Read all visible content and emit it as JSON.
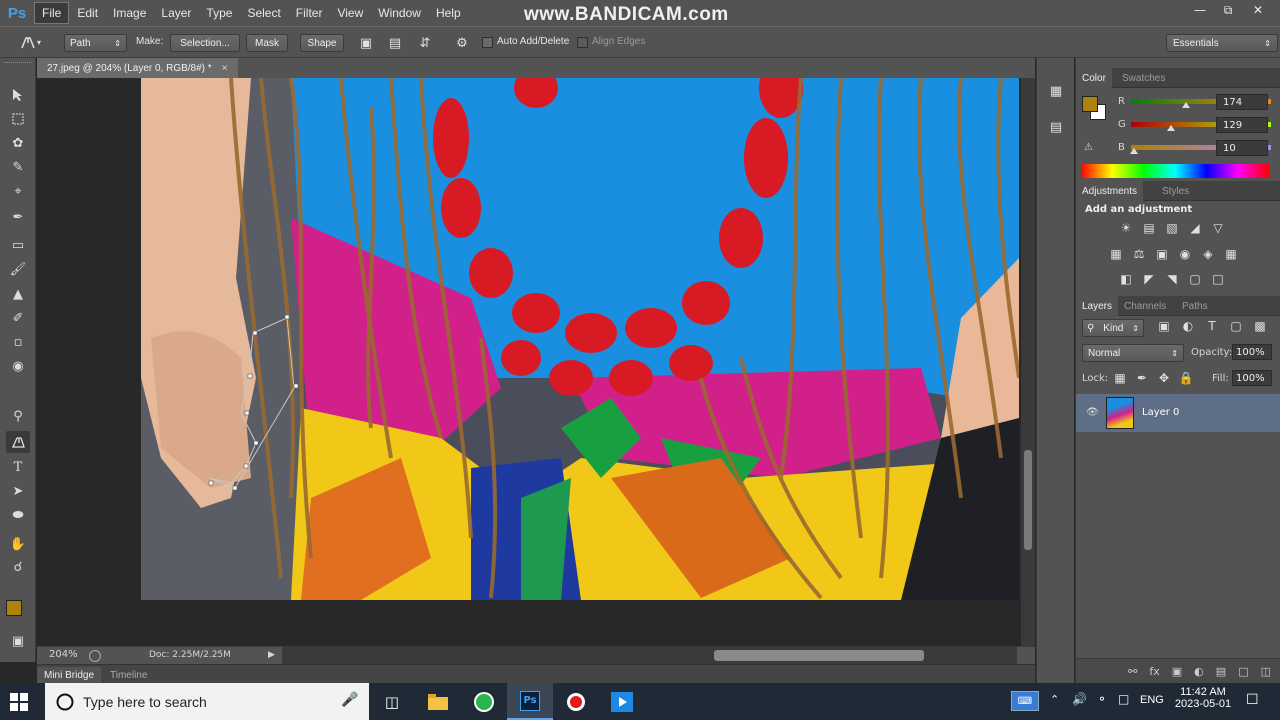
{
  "app": {
    "logo": "Ps"
  },
  "menu": [
    "File",
    "Edit",
    "Image",
    "Layer",
    "Type",
    "Select",
    "Filter",
    "View",
    "Window",
    "Help"
  ],
  "watermark": "www.BANDICAM.com",
  "options": {
    "mode": "Path",
    "make_label": "Make:",
    "selection_btn": "Selection...",
    "mask_btn": "Mask",
    "shape_btn": "Shape",
    "auto_add_delete": "Auto Add/Delete",
    "align_edges": "Align Edges",
    "workspace": "Essentials"
  },
  "document": {
    "tab_title": "27.jpeg @ 204% (Layer 0, RGB/8#) *",
    "close_glyph": "×",
    "zoom": "204%",
    "doc_size": "Doc: 2.25M/2.25M"
  },
  "bottom_tabs": [
    "Mini Bridge",
    "Timeline"
  ],
  "color_panel": {
    "tabs": [
      "Color",
      "Swatches"
    ],
    "r_label": "R",
    "g_label": "G",
    "b_label": "B",
    "r": 174,
    "g": 129,
    "b": 10,
    "foreground": "#ae810a"
  },
  "adjustments_panel": {
    "tabs": [
      "Adjustments",
      "Styles"
    ],
    "heading": "Add an adjustment"
  },
  "layers_panel": {
    "tabs": [
      "Layers",
      "Channels",
      "Paths"
    ],
    "filter": "Kind",
    "blend_mode": "Normal",
    "opacity_label": "Opacity:",
    "opacity": "100%",
    "lock_label": "Lock:",
    "fill_label": "Fill:",
    "fill": "100%",
    "layer_name": "Layer 0"
  },
  "taskbar": {
    "search_placeholder": "Type here to search",
    "lang": "ENG",
    "time": "11:42 AM",
    "date": "2023-05-01"
  }
}
